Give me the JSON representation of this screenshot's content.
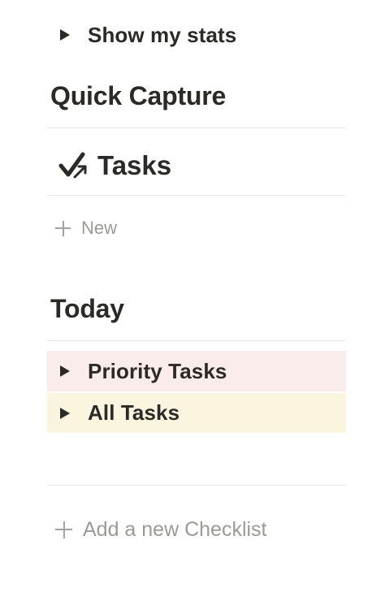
{
  "stats_toggle": {
    "label": "Show my stats"
  },
  "quick_capture": {
    "heading": "Quick Capture",
    "tasks_link": {
      "label": "Tasks",
      "icon": "check-arrow-icon"
    },
    "new_label": "New"
  },
  "today": {
    "heading": "Today",
    "items": [
      {
        "label": "Priority Tasks",
        "color": "#fbecec"
      },
      {
        "label": "All Tasks",
        "color": "#fbf4de"
      }
    ]
  },
  "add_checklist_label": "Add a new Checklist"
}
